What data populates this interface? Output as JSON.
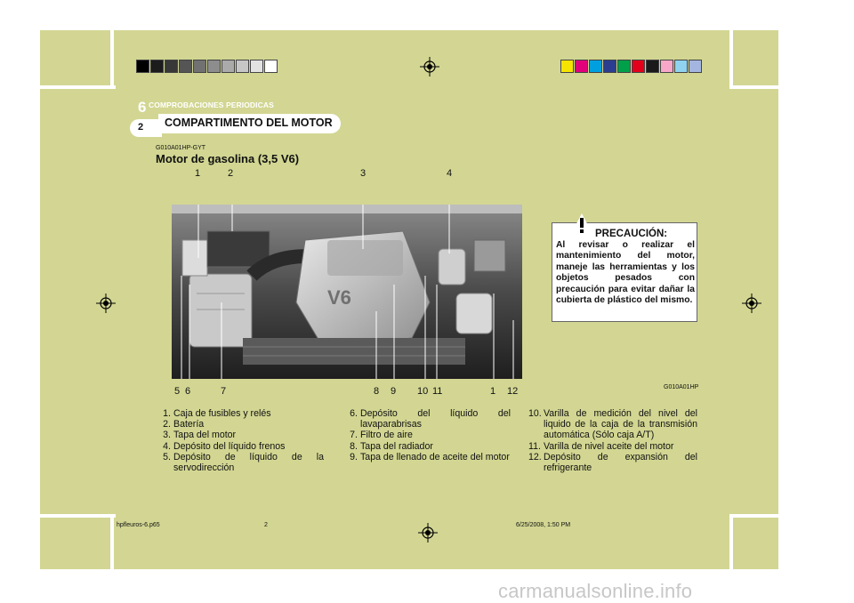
{
  "header": {
    "chapter_number": "6",
    "chapter_title": "COMPROBACIONES PERIODICAS",
    "page_number": "2",
    "section_title": "COMPARTIMENTO DEL MOTOR"
  },
  "content": {
    "code": "G010A01HP-GYT",
    "subtitle": "Motor de gasolina (3,5 V6)",
    "figure_code": "G010A01HP",
    "engine_badge": "V6",
    "callouts_top": [
      "1",
      "2",
      "3",
      "4"
    ],
    "callouts_bottom": [
      "5",
      "6",
      "7",
      "8",
      "9",
      "10",
      "11",
      "1",
      "12"
    ]
  },
  "warning": {
    "title": "PRECAUCIÓN:",
    "text": "Al revisar o realizar el mantenimiento del motor, maneje las herramientas y los objetos pesados con precaución para evitar dañar la cubierta de plástico del mismo."
  },
  "list_col1": [
    {
      "n": "1.",
      "t": "Caja de fusibles y relés"
    },
    {
      "n": "2.",
      "t": "Batería"
    },
    {
      "n": "3.",
      "t": "Tapa del motor"
    },
    {
      "n": "4.",
      "t": "Depósito del líquido frenos"
    },
    {
      "n": "5.",
      "t": "Depósito de líquido de la servodirección"
    }
  ],
  "list_col2": [
    {
      "n": "6.",
      "t": "Depósito del líquido del lavaparabrisas"
    },
    {
      "n": "7.",
      "t": "Filtro de aire"
    },
    {
      "n": "8.",
      "t": "Tapa del radiador"
    },
    {
      "n": "9.",
      "t": "Tapa de llenado de aceite del motor"
    }
  ],
  "list_col3": [
    {
      "n": "10.",
      "t": "Varilla de medición del nivel del liquido de la caja de la transmisión automática (Sólo caja A/T)"
    },
    {
      "n": "11.",
      "t": "Varilla de nivel aceite del motor"
    },
    {
      "n": "12.",
      "t": "Depósito de expansión del refrigerante"
    }
  ],
  "footer": {
    "file": "hpfleuros-6.p65",
    "page": "2",
    "date": "6/25/2008, 1:50 PM"
  },
  "watermark": "carmanualsonline.info",
  "colors": {
    "background": "#d2d692",
    "gray_swatches": [
      "#000000",
      "#1c1c1c",
      "#383838",
      "#555555",
      "#717171",
      "#8d8d8d",
      "#aaaaaa",
      "#c6c6c6",
      "#e2e2e2",
      "#ffffff"
    ],
    "color_swatches": [
      "#f5e400",
      "#e0007a",
      "#00a0e0",
      "#2a3d8f",
      "#00a04a",
      "#e3001b",
      "#1a1a1a",
      "#f7a8c8",
      "#8fd3f0",
      "#a4b6e0"
    ]
  }
}
